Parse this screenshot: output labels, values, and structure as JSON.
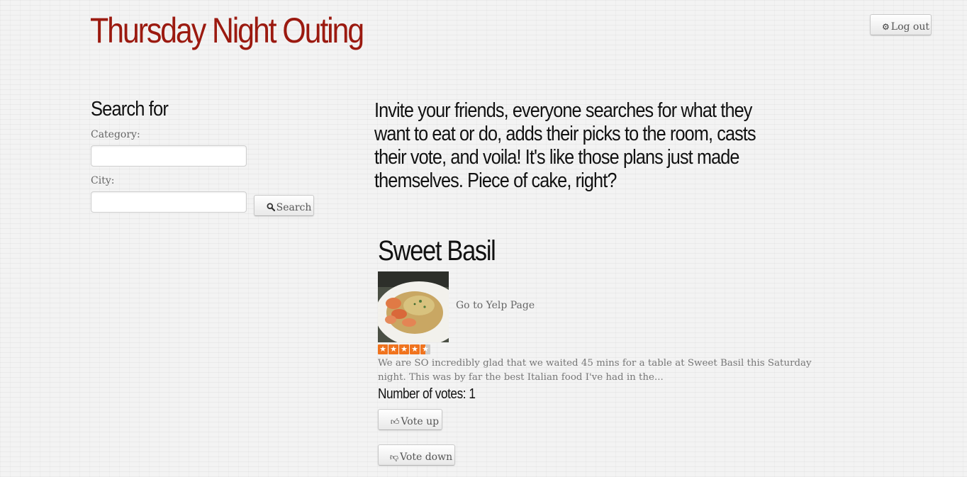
{
  "header": {
    "title": "Thursday Night Outing",
    "logout_label": "Log out",
    "logout_icon": "gear-icon"
  },
  "search": {
    "heading": "Search for",
    "category_label": "Category:",
    "category_value": "",
    "city_label": "City:",
    "city_value": "",
    "button_label": "Search",
    "button_icon": "search-icon"
  },
  "intro": {
    "text": "Invite your friends, everyone searches for what they want to eat or do, adds their picks to the room, casts their vote, and voila! It's like those plans just made themselves. Piece of cake, right?"
  },
  "result": {
    "name": "Sweet Basil",
    "yelp_link": "Go to Yelp Page",
    "rating": 4.5,
    "rating_max": 5,
    "review_snippet": "We are SO incredibly glad that we waited 45 mins for a table at Sweet Basil this Saturday night. This was by far the best Italian food I've had in the...",
    "votes_text": "Number of votes: 1",
    "vote_up_label": "Vote up",
    "vote_down_label": "Vote down"
  },
  "colors": {
    "brand_red": "#9b1a10",
    "star_orange": "#f0731e",
    "star_empty": "#cccccc"
  }
}
